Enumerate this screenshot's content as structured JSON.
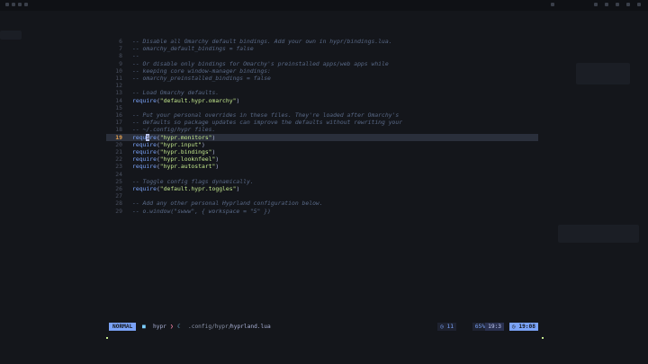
{
  "editor": {
    "lines": [
      {
        "n": "6",
        "parts": [
          {
            "t": "-- Disable all Omarchy default bindings. Add your own in hypr/bindings.lua.",
            "c": "cm"
          }
        ]
      },
      {
        "n": "7",
        "parts": [
          {
            "t": "-- omarchy_default_bindings = false",
            "c": "cm"
          }
        ]
      },
      {
        "n": "8",
        "parts": [
          {
            "t": "--",
            "c": "cm"
          }
        ]
      },
      {
        "n": "9",
        "parts": [
          {
            "t": "-- Or disable only bindings for Omarchy's preinstalled apps/web apps while",
            "c": "cm"
          }
        ]
      },
      {
        "n": "10",
        "parts": [
          {
            "t": "-- keeping core window-manager bindings:",
            "c": "cm"
          }
        ]
      },
      {
        "n": "11",
        "parts": [
          {
            "t": "-- omarchy_preinstalled_bindings = false",
            "c": "cm"
          }
        ]
      },
      {
        "n": "12",
        "parts": []
      },
      {
        "n": "13",
        "parts": [
          {
            "t": "-- Load Omarchy defaults.",
            "c": "cm"
          }
        ]
      },
      {
        "n": "14",
        "parts": [
          {
            "t": "require",
            "c": "fn"
          },
          {
            "t": "(",
            "c": "pn"
          },
          {
            "t": "\"default.hypr.omarchy\"",
            "c": "st"
          },
          {
            "t": ")",
            "c": "pn"
          }
        ]
      },
      {
        "n": "15",
        "parts": []
      },
      {
        "n": "16",
        "parts": [
          {
            "t": "-- Put your personal overrides in these files. They're loaded after Omarchy's",
            "c": "cm"
          }
        ]
      },
      {
        "n": "17",
        "parts": [
          {
            "t": "-- defaults so package updates can improve the defaults without rewriting your",
            "c": "cm"
          }
        ]
      },
      {
        "n": "18",
        "parts": [
          {
            "t": "-- ~/.config/hypr files.",
            "c": "cm"
          }
        ]
      },
      {
        "n": "19",
        "active": true,
        "parts": [
          {
            "t": "requ",
            "c": "fn"
          },
          {
            "t": "i",
            "c": "cursor"
          },
          {
            "t": "re",
            "c": "fn"
          },
          {
            "t": "(",
            "c": "pn"
          },
          {
            "t": "\"hypr.monitors\"",
            "c": "st"
          },
          {
            "t": ")",
            "c": "pn"
          }
        ]
      },
      {
        "n": "20",
        "parts": [
          {
            "t": "require",
            "c": "fn"
          },
          {
            "t": "(",
            "c": "pn"
          },
          {
            "t": "\"hypr.input\"",
            "c": "st"
          },
          {
            "t": ")",
            "c": "pn"
          }
        ]
      },
      {
        "n": "21",
        "parts": [
          {
            "t": "require",
            "c": "fn"
          },
          {
            "t": "(",
            "c": "pn"
          },
          {
            "t": "\"hypr.bindings\"",
            "c": "st"
          },
          {
            "t": ")",
            "c": "pn"
          }
        ]
      },
      {
        "n": "22",
        "parts": [
          {
            "t": "require",
            "c": "fn"
          },
          {
            "t": "(",
            "c": "pn"
          },
          {
            "t": "\"hypr.looknfeel\"",
            "c": "st"
          },
          {
            "t": ")",
            "c": "pn"
          }
        ]
      },
      {
        "n": "23",
        "parts": [
          {
            "t": "require",
            "c": "fn"
          },
          {
            "t": "(",
            "c": "pn"
          },
          {
            "t": "\"hypr.autostart\"",
            "c": "st"
          },
          {
            "t": ")",
            "c": "pn"
          }
        ]
      },
      {
        "n": "24",
        "parts": []
      },
      {
        "n": "25",
        "parts": [
          {
            "t": "-- Toggle config flags dynamically.",
            "c": "cm"
          }
        ]
      },
      {
        "n": "26",
        "parts": [
          {
            "t": "require",
            "c": "fn"
          },
          {
            "t": "(",
            "c": "pn"
          },
          {
            "t": "\"default.hypr.toggles\"",
            "c": "st"
          },
          {
            "t": ")",
            "c": "pn"
          }
        ]
      },
      {
        "n": "27",
        "parts": []
      },
      {
        "n": "28",
        "parts": [
          {
            "t": "-- Add any other personal Hyprland configuration below.",
            "c": "cm"
          }
        ]
      },
      {
        "n": "29",
        "parts": [
          {
            "t": "-- o.window(\"swww\", { workspace = \"5\" })",
            "c": "cm"
          }
        ]
      }
    ]
  },
  "statusline": {
    "mode": "NORMAL",
    "project": "hypr",
    "file_dir": ".config/hypr/",
    "file_name": "hyprland.lua",
    "diagnostics": "11",
    "percent": "65%",
    "position": "19:3",
    "clock": "19:08"
  },
  "colors": {
    "background": "#14161b",
    "accent": "#7aa2f7",
    "comment": "#5a6a88",
    "string": "#c3e88d",
    "cursor_line_number": "#e5a050"
  }
}
